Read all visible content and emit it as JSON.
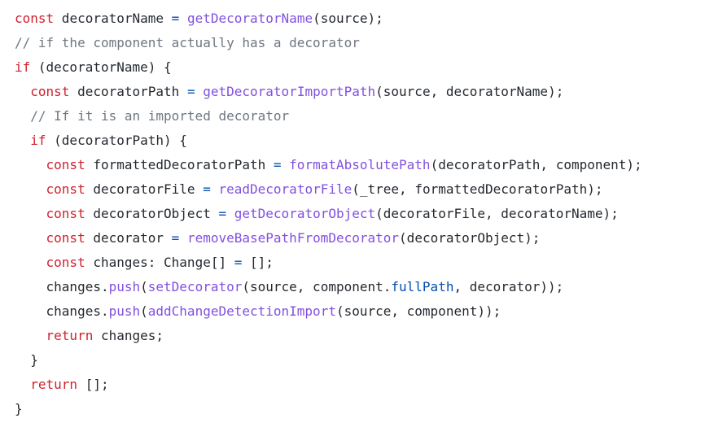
{
  "colors": {
    "keyword": "#cf222e",
    "function": "#8250df",
    "comment": "#6e7781",
    "operator": "#0550ae",
    "property": "#0550ae",
    "text": "#24292f",
    "background": "#ffffff"
  },
  "lines": [
    {
      "tokens": [
        {
          "t": "tx",
          "v": "//"
        }
      ]
    },
    {
      "tokens": [
        {
          "t": "kw",
          "v": "const"
        },
        {
          "t": "tx",
          "v": " decoratorName "
        },
        {
          "t": "op",
          "v": "="
        },
        {
          "t": "tx",
          "v": " "
        },
        {
          "t": "fn",
          "v": "getDecoratorName"
        },
        {
          "t": "tx",
          "v": "(source);"
        }
      ]
    },
    {
      "tokens": [
        {
          "t": "cm",
          "v": "// if the component actually has a decorator"
        }
      ]
    },
    {
      "tokens": [
        {
          "t": "kw",
          "v": "if"
        },
        {
          "t": "tx",
          "v": " (decoratorName) {"
        }
      ]
    },
    {
      "tokens": [
        {
          "t": "tx",
          "v": "  "
        },
        {
          "t": "kw",
          "v": "const"
        },
        {
          "t": "tx",
          "v": " decoratorPath "
        },
        {
          "t": "op",
          "v": "="
        },
        {
          "t": "tx",
          "v": " "
        },
        {
          "t": "fn",
          "v": "getDecoratorImportPath"
        },
        {
          "t": "tx",
          "v": "(source, decoratorName);"
        }
      ]
    },
    {
      "tokens": [
        {
          "t": "tx",
          "v": "  "
        },
        {
          "t": "cm",
          "v": "// If it is an imported decorator"
        }
      ]
    },
    {
      "tokens": [
        {
          "t": "tx",
          "v": "  "
        },
        {
          "t": "kw",
          "v": "if"
        },
        {
          "t": "tx",
          "v": " (decoratorPath) {"
        }
      ]
    },
    {
      "tokens": [
        {
          "t": "tx",
          "v": "    "
        },
        {
          "t": "kw",
          "v": "const"
        },
        {
          "t": "tx",
          "v": " formattedDecoratorPath "
        },
        {
          "t": "op",
          "v": "="
        },
        {
          "t": "tx",
          "v": " "
        },
        {
          "t": "fn",
          "v": "formatAbsolutePath"
        },
        {
          "t": "tx",
          "v": "(decoratorPath, component);"
        }
      ]
    },
    {
      "tokens": [
        {
          "t": "tx",
          "v": "    "
        },
        {
          "t": "kw",
          "v": "const"
        },
        {
          "t": "tx",
          "v": " decoratorFile "
        },
        {
          "t": "op",
          "v": "="
        },
        {
          "t": "tx",
          "v": " "
        },
        {
          "t": "fn",
          "v": "readDecoratorFile"
        },
        {
          "t": "tx",
          "v": "(_tree, formattedDecoratorPath);"
        }
      ]
    },
    {
      "tokens": [
        {
          "t": "tx",
          "v": "    "
        },
        {
          "t": "kw",
          "v": "const"
        },
        {
          "t": "tx",
          "v": " decoratorObject "
        },
        {
          "t": "op",
          "v": "="
        },
        {
          "t": "tx",
          "v": " "
        },
        {
          "t": "fn",
          "v": "getDecoratorObject"
        },
        {
          "t": "tx",
          "v": "(decoratorFile, decoratorName);"
        }
      ]
    },
    {
      "tokens": [
        {
          "t": "tx",
          "v": "    "
        },
        {
          "t": "kw",
          "v": "const"
        },
        {
          "t": "tx",
          "v": " decorator "
        },
        {
          "t": "op",
          "v": "="
        },
        {
          "t": "tx",
          "v": " "
        },
        {
          "t": "fn",
          "v": "removeBasePathFromDecorator"
        },
        {
          "t": "tx",
          "v": "(decoratorObject);"
        }
      ]
    },
    {
      "tokens": [
        {
          "t": "tx",
          "v": "    "
        },
        {
          "t": "kw",
          "v": "const"
        },
        {
          "t": "tx",
          "v": " changes: Change[] "
        },
        {
          "t": "op",
          "v": "="
        },
        {
          "t": "tx",
          "v": " [];"
        }
      ]
    },
    {
      "tokens": [
        {
          "t": "tx",
          "v": "    changes."
        },
        {
          "t": "fn",
          "v": "push"
        },
        {
          "t": "tx",
          "v": "("
        },
        {
          "t": "fn",
          "v": "setDecorator"
        },
        {
          "t": "tx",
          "v": "(source, component."
        },
        {
          "t": "pr",
          "v": "fullPath"
        },
        {
          "t": "tx",
          "v": ", decorator));"
        }
      ]
    },
    {
      "tokens": [
        {
          "t": "tx",
          "v": "    changes."
        },
        {
          "t": "fn",
          "v": "push"
        },
        {
          "t": "tx",
          "v": "("
        },
        {
          "t": "fn",
          "v": "addChangeDetectionImport"
        },
        {
          "t": "tx",
          "v": "(source, component));"
        }
      ]
    },
    {
      "tokens": [
        {
          "t": "tx",
          "v": "    "
        },
        {
          "t": "kw",
          "v": "return"
        },
        {
          "t": "tx",
          "v": " changes;"
        }
      ]
    },
    {
      "tokens": [
        {
          "t": "tx",
          "v": "  }"
        }
      ]
    },
    {
      "tokens": [
        {
          "t": "tx",
          "v": "  "
        },
        {
          "t": "kw",
          "v": "return"
        },
        {
          "t": "tx",
          "v": " [];"
        }
      ]
    },
    {
      "tokens": [
        {
          "t": "tx",
          "v": "}"
        }
      ]
    }
  ]
}
